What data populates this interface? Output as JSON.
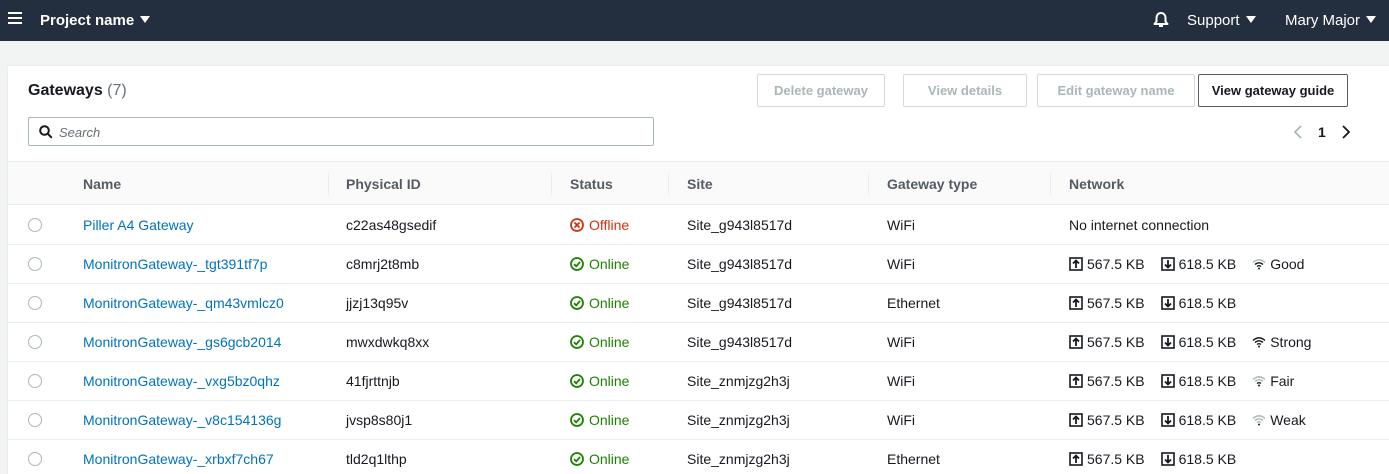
{
  "nav": {
    "project": "Project name",
    "support": "Support",
    "user": "Mary Major"
  },
  "panel": {
    "title": "Gateways",
    "count": "(7)",
    "buttons": {
      "delete": "Delete gateway",
      "details": "View details",
      "edit": "Edit gateway name",
      "guide": "View gateway guide"
    },
    "search_placeholder": "Search",
    "page": "1"
  },
  "table": {
    "headers": [
      "Name",
      "Physical ID",
      "Status",
      "Site",
      "Gateway type",
      "Network"
    ],
    "rows": [
      {
        "name": "Piller A4 Gateway",
        "pid": "c22as48gsedif",
        "status": "Offline",
        "site": "Site_g943l8517d",
        "type": "WiFi",
        "network": "No internet connection",
        "up": "",
        "down": "",
        "signal": ""
      },
      {
        "name": "MonitronGateway-_tgt391tf7p",
        "pid": "c8mrj2t8mb",
        "status": "Online",
        "site": "Site_g943l8517d",
        "type": "WiFi",
        "network": "",
        "up": "567.5 KB",
        "down": "618.5 KB",
        "signal": "Good"
      },
      {
        "name": "MonitronGateway-_qm43vmlcz0",
        "pid": "jjzj13q95v",
        "status": "Online",
        "site": "Site_g943l8517d",
        "type": "Ethernet",
        "network": "",
        "up": "567.5 KB",
        "down": "618.5 KB",
        "signal": ""
      },
      {
        "name": "MonitronGateway-_gs6gcb2014",
        "pid": "mwxdwkq8xx",
        "status": "Online",
        "site": "Site_g943l8517d",
        "type": "WiFi",
        "network": "",
        "up": "567.5 KB",
        "down": "618.5 KB",
        "signal": "Strong"
      },
      {
        "name": "MonitronGateway-_vxg5bz0qhz",
        "pid": "41fjrttnjb",
        "status": "Online",
        "site": "Site_znmjzg2h3j",
        "type": "WiFi",
        "network": "",
        "up": "567.5 KB",
        "down": "618.5 KB",
        "signal": "Fair"
      },
      {
        "name": "MonitronGateway-_v8c154136g",
        "pid": "jvsp8s80j1",
        "status": "Online",
        "site": "Site_znmjzg2h3j",
        "type": "WiFi",
        "network": "",
        "up": "567.5 KB",
        "down": "618.5 KB",
        "signal": "Weak"
      },
      {
        "name": "MonitronGateway-_xrbxf7ch67",
        "pid": "tld2q1lthp",
        "status": "Online",
        "site": "Site_znmjzg2h3j",
        "type": "Ethernet",
        "network": "",
        "up": "567.5 KB",
        "down": "618.5 KB",
        "signal": ""
      }
    ]
  },
  "icons": {
    "menu": "hamburger-menu-icon",
    "notifications": "bell-icon",
    "search": "search-icon",
    "offline": "x-circle-icon",
    "online": "check-circle-icon",
    "upload": "upload-icon",
    "download": "download-icon",
    "signal": "wifi-signal-icon"
  },
  "colors": {
    "nav_bg": "#232f3e",
    "link": "#0073bb",
    "online": "#1d8102",
    "offline": "#d13212"
  }
}
